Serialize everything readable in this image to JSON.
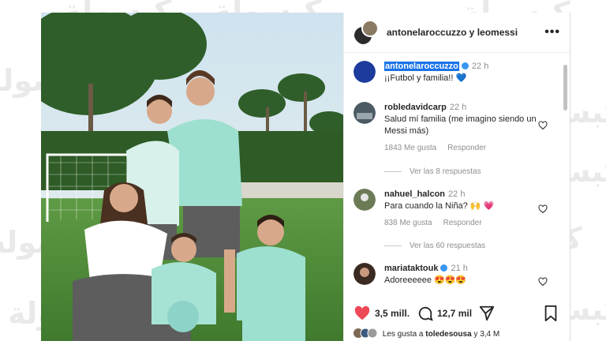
{
  "watermark": "كبسولة",
  "post_header": {
    "title": "antonelaroccuzzo y leomessi",
    "more": "•••"
  },
  "caption": {
    "user": "antonelaroccuzzo",
    "time": "22 h",
    "text": "¡¡Futbol y familia!! 💙"
  },
  "comments": [
    {
      "user": "robledavidcarp",
      "time": "22 h",
      "text": "Salud mí familia (me imagino siendo un Messi más)",
      "likes": "1843 Me gusta",
      "reply": "Responder",
      "see_replies": "Ver las 8 respuestas"
    },
    {
      "user": "nahuel_halcon",
      "time": "22 h",
      "text": "Para cuando la Niña? 🙌 💗",
      "likes": "838 Me gusta",
      "reply": "Responder",
      "see_replies": "Ver las 60 respuestas"
    },
    {
      "user": "mariataktouk",
      "time": "21 h",
      "text": "Adoreeeeee 😍😍😍"
    }
  ],
  "actions": {
    "likes_count": "3,5 mill.",
    "comments_count": "12,7 mil"
  },
  "liked_by": {
    "prefix": "Les gusta a",
    "user": "toledesousa",
    "suffix": "y 3,4 M"
  },
  "colors": {
    "like_red": "#ed4956",
    "verified_blue": "#3897f0",
    "selection": "#1a73e8"
  },
  "icons": [
    "heart-icon",
    "comment-icon",
    "share-icon",
    "bookmark-icon",
    "chevron-right-icon"
  ]
}
